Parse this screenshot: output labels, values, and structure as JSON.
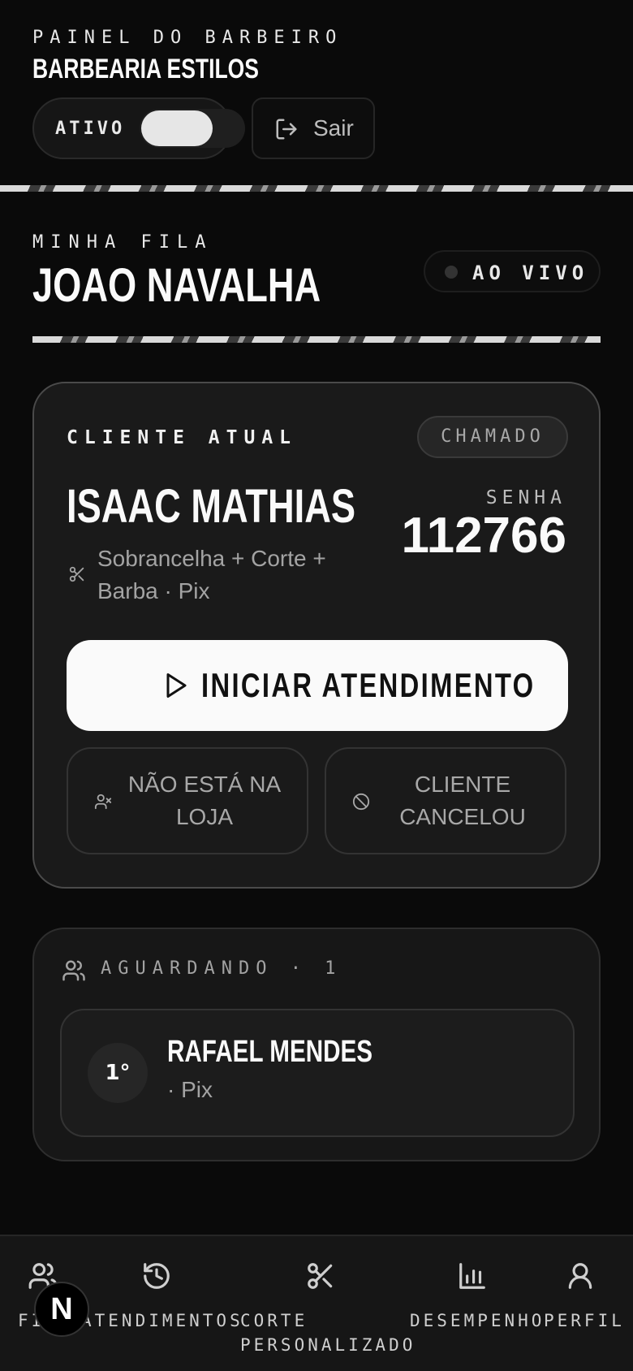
{
  "header": {
    "eyebrow": "PAINEL DO BARBEIRO",
    "shop_name": "BARBEARIA ESTILOS",
    "toggle_label": "ATIVO",
    "toggle_on": true,
    "logout_label": "Sair"
  },
  "queue": {
    "eyebrow": "MINHA FILA",
    "barber_name": "JOAO NAVALHA",
    "live_label": "AO VIVO"
  },
  "current_client": {
    "eyebrow": "CLIENTE ATUAL",
    "status": "CHAMADO",
    "name": "ISAAC MATHIAS",
    "service": "Sobrancelha + Corte + Barba · Pix",
    "ticket_label": "SENHA",
    "ticket_number": "112766",
    "start_label": "INICIAR ATENDIMENTO",
    "not_in_store_label": "NÃO ESTÁ NA LOJA",
    "cancelled_label": "CLIENTE CANCELOU"
  },
  "waiting": {
    "label": "AGUARDANDO · 1",
    "items": [
      {
        "position": "1°",
        "name": "RAFAEL MENDES",
        "meta": "· Pix"
      }
    ]
  },
  "nav": {
    "items": [
      {
        "label": "FILA",
        "icon": "users-icon"
      },
      {
        "label": "ATENDIMENTOS",
        "icon": "history-icon"
      },
      {
        "label_line1": "CORTE",
        "label_line2": "PERSONALIZADO",
        "icon": "scissors-icon"
      },
      {
        "label": "DESEMPENHO",
        "icon": "bar-chart-icon"
      },
      {
        "label": "PERFIL",
        "icon": "user-icon"
      }
    ],
    "badge": "N"
  }
}
